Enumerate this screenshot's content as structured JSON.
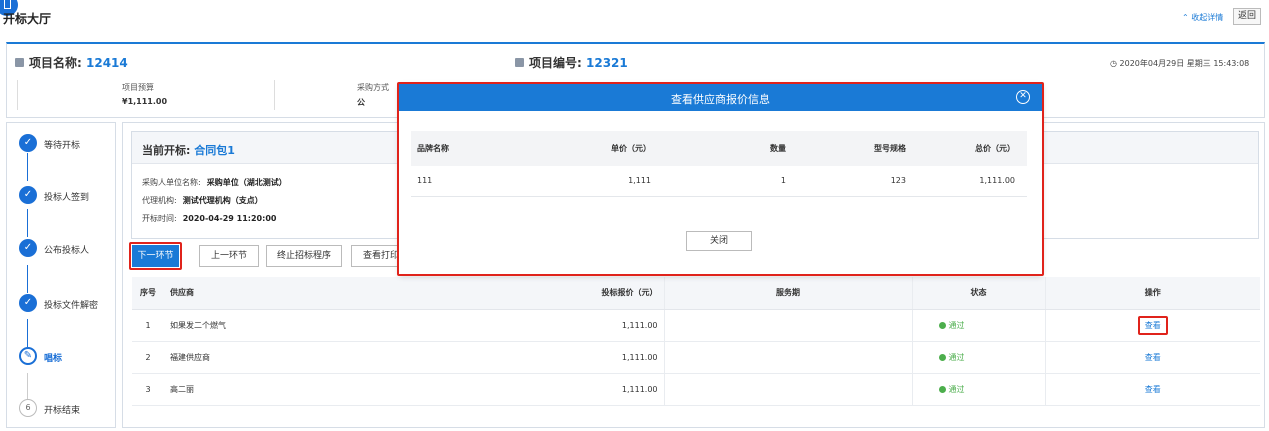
{
  "header": {
    "title": "开标大厅",
    "collapse_label": "收起详情",
    "collapse_icon": "chevron-up-icon",
    "back_label": "返回"
  },
  "project": {
    "name_label": "项目名称:",
    "name_value": "12414",
    "code_label": "项目编号:",
    "code_value": "12321",
    "datetime": "2020年04月29日 星期三 15:43:08",
    "budget_label": "项目预算",
    "budget_value": "¥1,111.00",
    "method_label": "采购方式",
    "method_value": "公"
  },
  "steps": [
    {
      "label": "等待开标",
      "status": "done"
    },
    {
      "label": "投标人签到",
      "status": "done"
    },
    {
      "label": "公布投标人",
      "status": "done"
    },
    {
      "label": "投标文件解密",
      "status": "done"
    },
    {
      "label": "唱标",
      "status": "active"
    },
    {
      "label": "开标结束",
      "status": "todo",
      "number": "6"
    }
  ],
  "package": {
    "title_label": "当前开标:",
    "title_value": "合同包1",
    "purchaser_label": "采购人单位名称:",
    "purchaser_value": "采购单位（湖北测试）",
    "agency_label": "代理机构:",
    "agency_value": "测试代理机构（支点）",
    "time_label": "开标时间:",
    "time_value": "2020-04-29 11:20:00"
  },
  "actions": {
    "next": "下一环节",
    "prev": "上一环节",
    "terminate": "终止招标程序",
    "print": "查看打印"
  },
  "bid_table": {
    "headers": [
      "序号",
      "供应商",
      "投标报价（元）",
      "服务期",
      "状态",
      "操作"
    ],
    "rows": [
      {
        "seq": "1",
        "supplier": "如果发二个燃气",
        "price": "1,111.00",
        "service": "",
        "status": "通过",
        "op": "查看"
      },
      {
        "seq": "2",
        "supplier": "福建供应商",
        "price": "1,111.00",
        "service": "",
        "status": "通过",
        "op": "查看"
      },
      {
        "seq": "3",
        "supplier": "高二丽",
        "price": "1,111.00",
        "service": "",
        "status": "通过",
        "op": "查看"
      }
    ]
  },
  "modal": {
    "title": "查看供应商报价信息",
    "headers": [
      "品牌名称",
      "单价（元）",
      "数量",
      "型号规格",
      "总价（元）"
    ],
    "rows": [
      {
        "brand": "111",
        "unit_price": "1,111",
        "qty": "1",
        "model": "123",
        "total": "1,111.00"
      }
    ],
    "close_label": "关闭"
  },
  "colors": {
    "accent": "#1a7ad6",
    "highlight": "#e0231b",
    "pass": "#4cae4c"
  }
}
